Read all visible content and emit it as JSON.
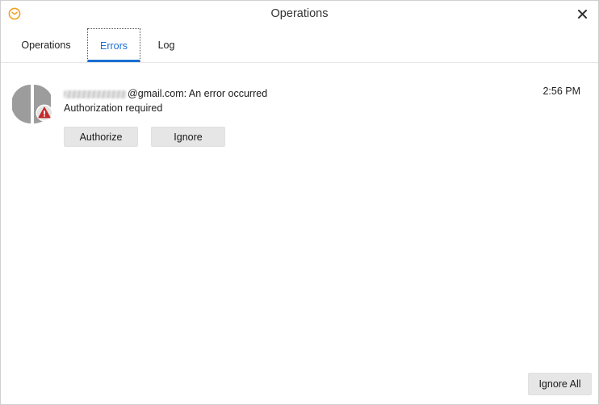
{
  "window": {
    "title": "Operations",
    "accent_color": "#1a6fd1",
    "app_icon": "envelope-icon"
  },
  "tabs": [
    {
      "label": "Operations",
      "active": false
    },
    {
      "label": "Errors",
      "active": true
    },
    {
      "label": "Log",
      "active": false
    }
  ],
  "errors": [
    {
      "account_suffix": "@gmail.com: An error occurred",
      "message": "Authorization required",
      "time": "2:56 PM",
      "badge_icon": "warning-icon",
      "badge_color": "#c42b2b",
      "actions": {
        "authorize": "Authorize",
        "ignore": "Ignore"
      }
    }
  ],
  "footer": {
    "ignore_all": "Ignore All"
  }
}
